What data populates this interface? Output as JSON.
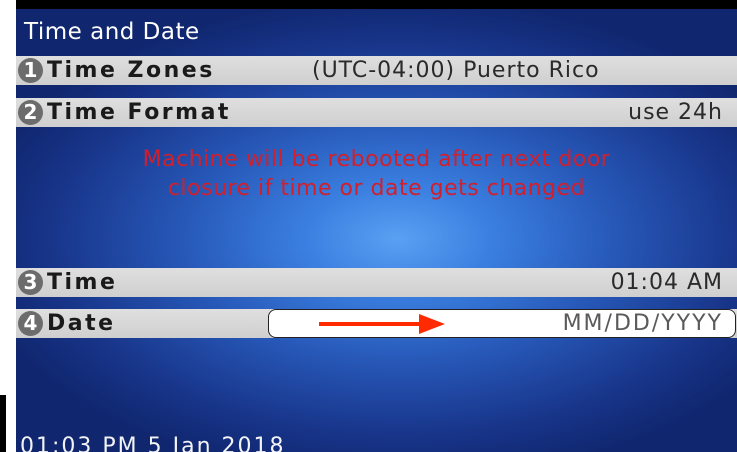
{
  "screen": {
    "title": "Time and Date",
    "rows": [
      {
        "num": "1",
        "label": "Time Zones",
        "value": "(UTC-04:00) Puerto Rico"
      },
      {
        "num": "2",
        "label": "Time Format",
        "value": "use 24h"
      },
      {
        "num": "3",
        "label": "Time",
        "value": "01:04 AM"
      },
      {
        "num": "4",
        "label": "Date",
        "placeholder": "MM/DD/YYYY"
      }
    ],
    "warning_line1": "Machine will be rebooted after next door",
    "warning_line2": "closure if time or date gets changed",
    "status_text": "01:03 PM 5 Jan 2018"
  },
  "colors": {
    "background_center": "#5aa0f2",
    "background_edge": "#10266e",
    "warning": "#d21f2c",
    "annotation_arrow": "#ff2a00"
  }
}
